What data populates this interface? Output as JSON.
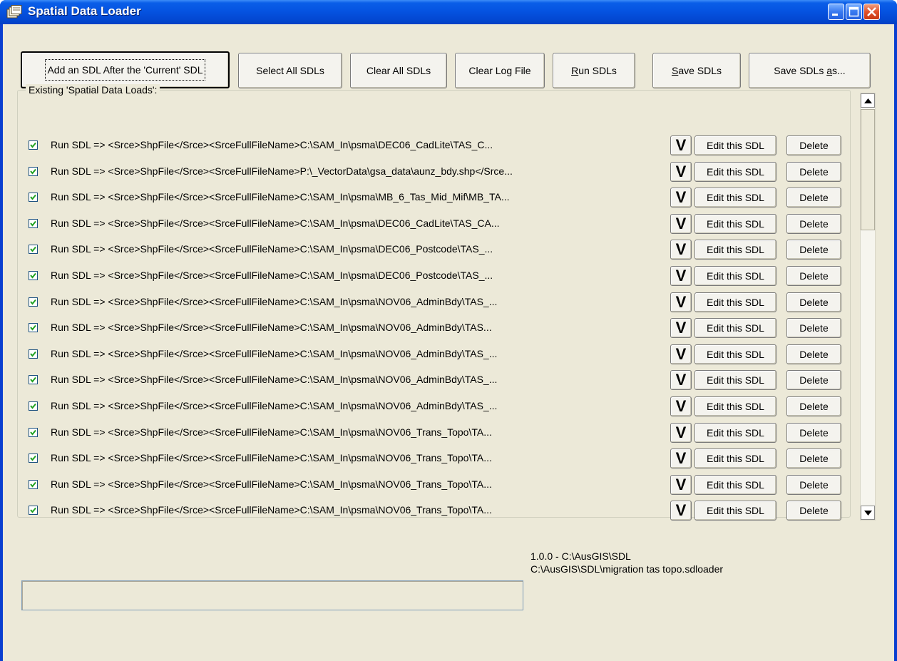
{
  "window": {
    "title": "Spatial Data Loader",
    "controls": [
      "minimize-icon",
      "maximize-icon",
      "close-icon"
    ]
  },
  "toolbar": {
    "add_sdl": "Add an SDL After the 'Current' SDL",
    "select_all": "Select All SDLs",
    "clear_all": "Clear All SDLs",
    "clear_log": "Clear Log File",
    "run_prefix": "R",
    "run_rest": "un SDLs",
    "save_prefix": "S",
    "save_rest": "ave SDLs",
    "save_as_main": "Save SDLs ",
    "save_as_accel": "a",
    "save_as_rest": "s..."
  },
  "group": {
    "label": "Existing 'Spatial Data Loads':"
  },
  "row_buttons": {
    "v_label": "V",
    "edit_label": "Edit this SDL",
    "delete_label": "Delete"
  },
  "sdl_rows": [
    {
      "checked": true,
      "text": "Run SDL => <Srce>ShpFile</Srce><SrceFullFileName>C:\\SAM_In\\psma\\DEC06_CadLite\\TAS_C..."
    },
    {
      "checked": true,
      "text": "Run SDL => <Srce>ShpFile</Srce><SrceFullFileName>P:\\_VectorData\\gsa_data\\aunz_bdy.shp</Srce..."
    },
    {
      "checked": true,
      "text": "Run SDL => <Srce>ShpFile</Srce><SrceFullFileName>C:\\SAM_In\\psma\\MB_6_Tas_Mid_Mif\\MB_TA..."
    },
    {
      "checked": true,
      "text": "Run SDL => <Srce>ShpFile</Srce><SrceFullFileName>C:\\SAM_In\\psma\\DEC06_CadLite\\TAS_CA..."
    },
    {
      "checked": true,
      "text": "Run SDL => <Srce>ShpFile</Srce><SrceFullFileName>C:\\SAM_In\\psma\\DEC06_Postcode\\TAS_..."
    },
    {
      "checked": true,
      "text": "Run SDL => <Srce>ShpFile</Srce><SrceFullFileName>C:\\SAM_In\\psma\\DEC06_Postcode\\TAS_..."
    },
    {
      "checked": true,
      "text": "Run SDL => <Srce>ShpFile</Srce><SrceFullFileName>C:\\SAM_In\\psma\\NOV06_AdminBdy\\TAS_..."
    },
    {
      "checked": true,
      "text": "Run SDL => <Srce>ShpFile</Srce><SrceFullFileName>C:\\SAM_In\\psma\\NOV06_AdminBdy\\TAS..."
    },
    {
      "checked": true,
      "text": "Run SDL => <Srce>ShpFile</Srce><SrceFullFileName>C:\\SAM_In\\psma\\NOV06_AdminBdy\\TAS_..."
    },
    {
      "checked": true,
      "text": "Run SDL => <Srce>ShpFile</Srce><SrceFullFileName>C:\\SAM_In\\psma\\NOV06_AdminBdy\\TAS_..."
    },
    {
      "checked": true,
      "text": "Run SDL => <Srce>ShpFile</Srce><SrceFullFileName>C:\\SAM_In\\psma\\NOV06_AdminBdy\\TAS_..."
    },
    {
      "checked": true,
      "text": "Run SDL => <Srce>ShpFile</Srce><SrceFullFileName>C:\\SAM_In\\psma\\NOV06_Trans_Topo\\TA..."
    },
    {
      "checked": true,
      "text": "Run SDL => <Srce>ShpFile</Srce><SrceFullFileName>C:\\SAM_In\\psma\\NOV06_Trans_Topo\\TA..."
    },
    {
      "checked": true,
      "text": "Run SDL => <Srce>ShpFile</Srce><SrceFullFileName>C:\\SAM_In\\psma\\NOV06_Trans_Topo\\TA..."
    },
    {
      "checked": true,
      "text": "Run SDL => <Srce>ShpFile</Srce><SrceFullFileName>C:\\SAM_In\\psma\\NOV06_Trans_Topo\\TA..."
    }
  ],
  "status": {
    "version_line": "1.0.0 - C:\\AusGIS\\SDL",
    "file_line": "C:\\AusGIS\\SDL\\migration tas topo.sdloader"
  },
  "log": {
    "value": ""
  },
  "colors": {
    "titlebar": "#0553e1",
    "window_bg": "#ece9d8"
  }
}
